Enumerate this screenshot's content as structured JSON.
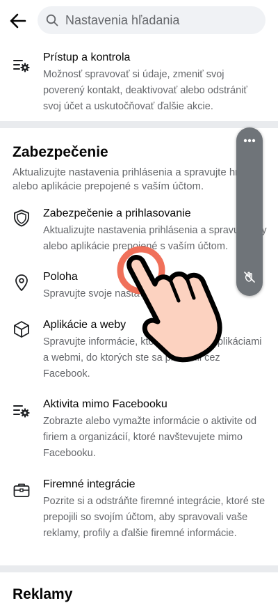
{
  "search": {
    "placeholder": "Nastavenia hľadania"
  },
  "top_item": {
    "title": "Prístup a kontrola",
    "desc": "Možnosť spravovať si údaje, zmeniť svoj poverený kontakt, deaktivovať alebo odstrániť svoj účet a uskutočňovať ďalšie akcie.",
    "icon": "settings-list-icon"
  },
  "security": {
    "title": "Zabezpečenie",
    "subtitle": "Aktualizujte nastavenia prihlásenia a spravujte hry alebo aplikácie prepojené s vaším účtom.",
    "items": [
      {
        "title": "Zabezpečenie a prihlasovanie",
        "desc": "Aktualizujte nastavenia prihlásenia a spravujte hry alebo aplikácie prepojené s vaším účtom.",
        "icon": "shield-icon"
      },
      {
        "title": "Poloha",
        "desc": "Spravujte svoje nastavenia polohy.",
        "icon": "location-pin-icon"
      },
      {
        "title": "Aplikácie a weby",
        "desc": "Spravujte informácie, ktoré zdieľate s aplikáciami a webmi, do ktorých ste sa prihlásili cez Facebook.",
        "icon": "cube-icon"
      },
      {
        "title": "Aktivita mimo Facebooku",
        "desc": "Zobrazte alebo vymažte informácie o aktivite od firiem a organizácií, ktoré navštevujete mimo Facebooku.",
        "icon": "settings-list-icon"
      },
      {
        "title": "Firemné integrácie",
        "desc": "Pozrite si a odstráňte firemné integrácie, ktoré ste prepojili so svojím účtom, aby spravovali vaše reklamy, profily a ďalšie firemné informácie.",
        "icon": "briefcase-icon"
      }
    ]
  },
  "next_section": {
    "title": "Reklamy"
  },
  "colors": {
    "accent": "#1877f2",
    "text": "#050505",
    "secondary": "#65676b",
    "divider": "#e9ebee",
    "float_bg": "#6f7479",
    "touch": "#f0705a",
    "hand": "#fcd2c0"
  }
}
